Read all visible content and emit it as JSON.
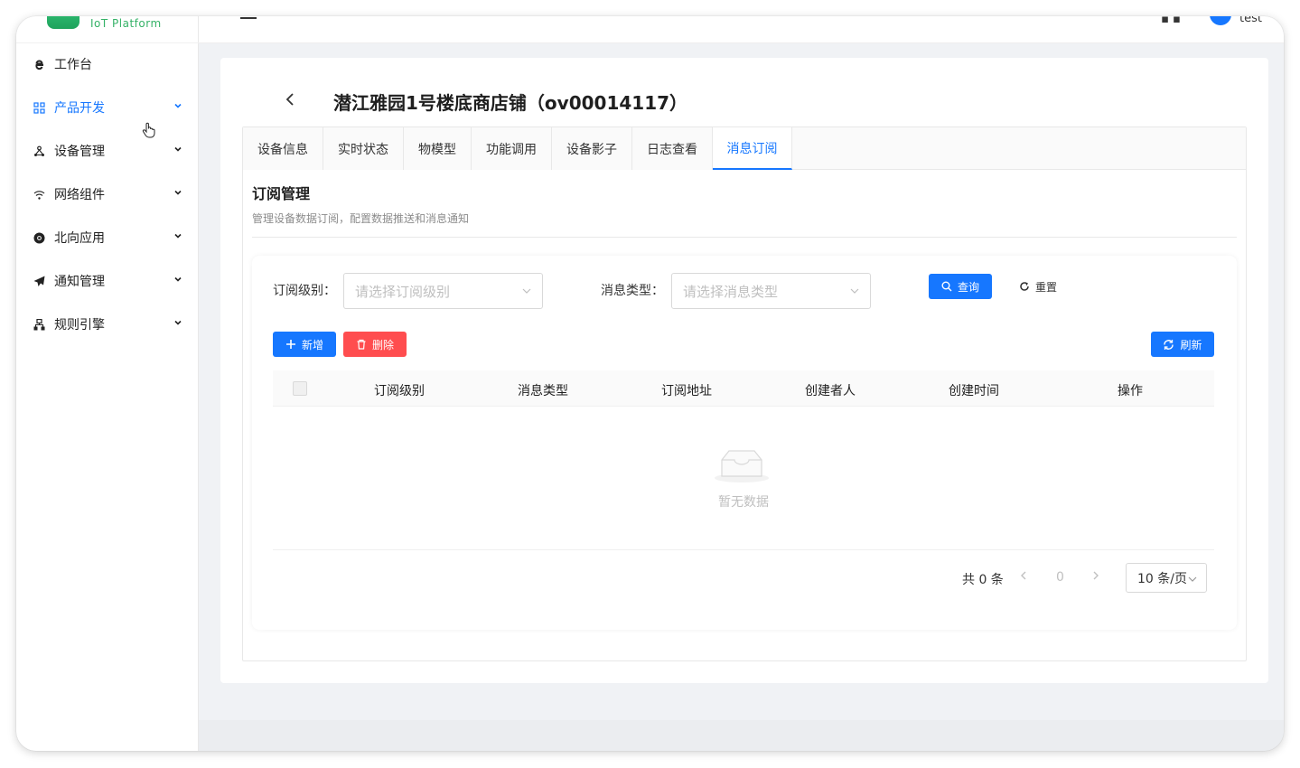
{
  "app": {
    "logo_text": "IoT Platform",
    "username": "test"
  },
  "sidebar": {
    "items": [
      {
        "label": "工作台",
        "icon": "ie-icon",
        "active": false,
        "expandable": false
      },
      {
        "label": "产品开发",
        "icon": "grid-icon",
        "active": true,
        "expandable": true
      },
      {
        "label": "设备管理",
        "icon": "nodes-icon",
        "active": false,
        "expandable": true
      },
      {
        "label": "网络组件",
        "icon": "wifi-icon",
        "active": false,
        "expandable": true
      },
      {
        "label": "北向应用",
        "icon": "chrome-icon",
        "active": false,
        "expandable": true
      },
      {
        "label": "通知管理",
        "icon": "send-icon",
        "active": false,
        "expandable": true
      },
      {
        "label": "规则引擎",
        "icon": "tree-icon",
        "active": false,
        "expandable": true
      }
    ]
  },
  "page": {
    "title": "潜江雅园1号楼底商店铺（ov00014117）"
  },
  "tabs": [
    {
      "label": "设备信息",
      "active": false
    },
    {
      "label": "实时状态",
      "active": false
    },
    {
      "label": "物模型",
      "active": false
    },
    {
      "label": "功能调用",
      "active": false
    },
    {
      "label": "设备影子",
      "active": false
    },
    {
      "label": "日志查看",
      "active": false
    },
    {
      "label": "消息订阅",
      "active": true
    }
  ],
  "section": {
    "title": "订阅管理",
    "description": "管理设备数据订阅，配置数据推送和消息通知"
  },
  "filters": {
    "level_label": "订阅级别：",
    "level_placeholder": "请选择订阅级别",
    "type_label": "消息类型：",
    "type_placeholder": "请选择消息类型",
    "query_label": "查询",
    "reset_label": "重置"
  },
  "actions": {
    "add_label": "新增",
    "delete_label": "删除",
    "refresh_label": "刷新"
  },
  "table": {
    "columns": [
      "订阅级别",
      "消息类型",
      "订阅地址",
      "创建者人",
      "创建时间",
      "操作"
    ],
    "rows": [],
    "empty_text": "暂无数据"
  },
  "pagination": {
    "total_text": "共 0 条",
    "current_page": "0",
    "page_size": "10 条/页"
  },
  "colors": {
    "primary": "#1677ff",
    "danger": "#ff4d4f",
    "logo_green": "#35b267"
  }
}
